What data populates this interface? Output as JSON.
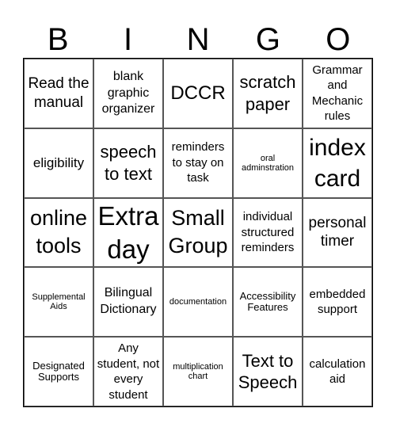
{
  "header": [
    "B",
    "I",
    "N",
    "G",
    "O"
  ],
  "cells": [
    [
      {
        "text": "Read the manual",
        "size": "s19"
      },
      {
        "text": "blank graphic organizer",
        "size": "s16"
      },
      {
        "text": "DCCR",
        "size": "s24"
      },
      {
        "text": "scratch paper",
        "size": "s22"
      },
      {
        "text": "Grammar and Mechanic rules",
        "size": "s15"
      }
    ],
    [
      {
        "text": "eligibility",
        "size": "s17"
      },
      {
        "text": "speech to text",
        "size": "s22"
      },
      {
        "text": "reminders to stay on task",
        "size": "s15"
      },
      {
        "text": "oral adminstration",
        "size": "s11"
      },
      {
        "text": "index card",
        "size": "s30"
      }
    ],
    [
      {
        "text": "online tools",
        "size": "s27"
      },
      {
        "text": "Extra day",
        "size": "s33"
      },
      {
        "text": "Small Group",
        "size": "s27"
      },
      {
        "text": "individual structured reminders",
        "size": "s15"
      },
      {
        "text": "personal timer",
        "size": "s19"
      }
    ],
    [
      {
        "text": "Supplemental Aids",
        "size": "s11"
      },
      {
        "text": "Bilingual Dictionary",
        "size": "s16"
      },
      {
        "text": "documentation",
        "size": "s11"
      },
      {
        "text": "Accessibility Features",
        "size": "s13"
      },
      {
        "text": "embedded support",
        "size": "s15"
      }
    ],
    [
      {
        "text": "Designated Supports",
        "size": "s13"
      },
      {
        "text": "Any student, not every student",
        "size": "s15"
      },
      {
        "text": "multiplication chart",
        "size": "s11"
      },
      {
        "text": "Text to Speech",
        "size": "s22"
      },
      {
        "text": "calculation aid",
        "size": "s15"
      }
    ]
  ]
}
